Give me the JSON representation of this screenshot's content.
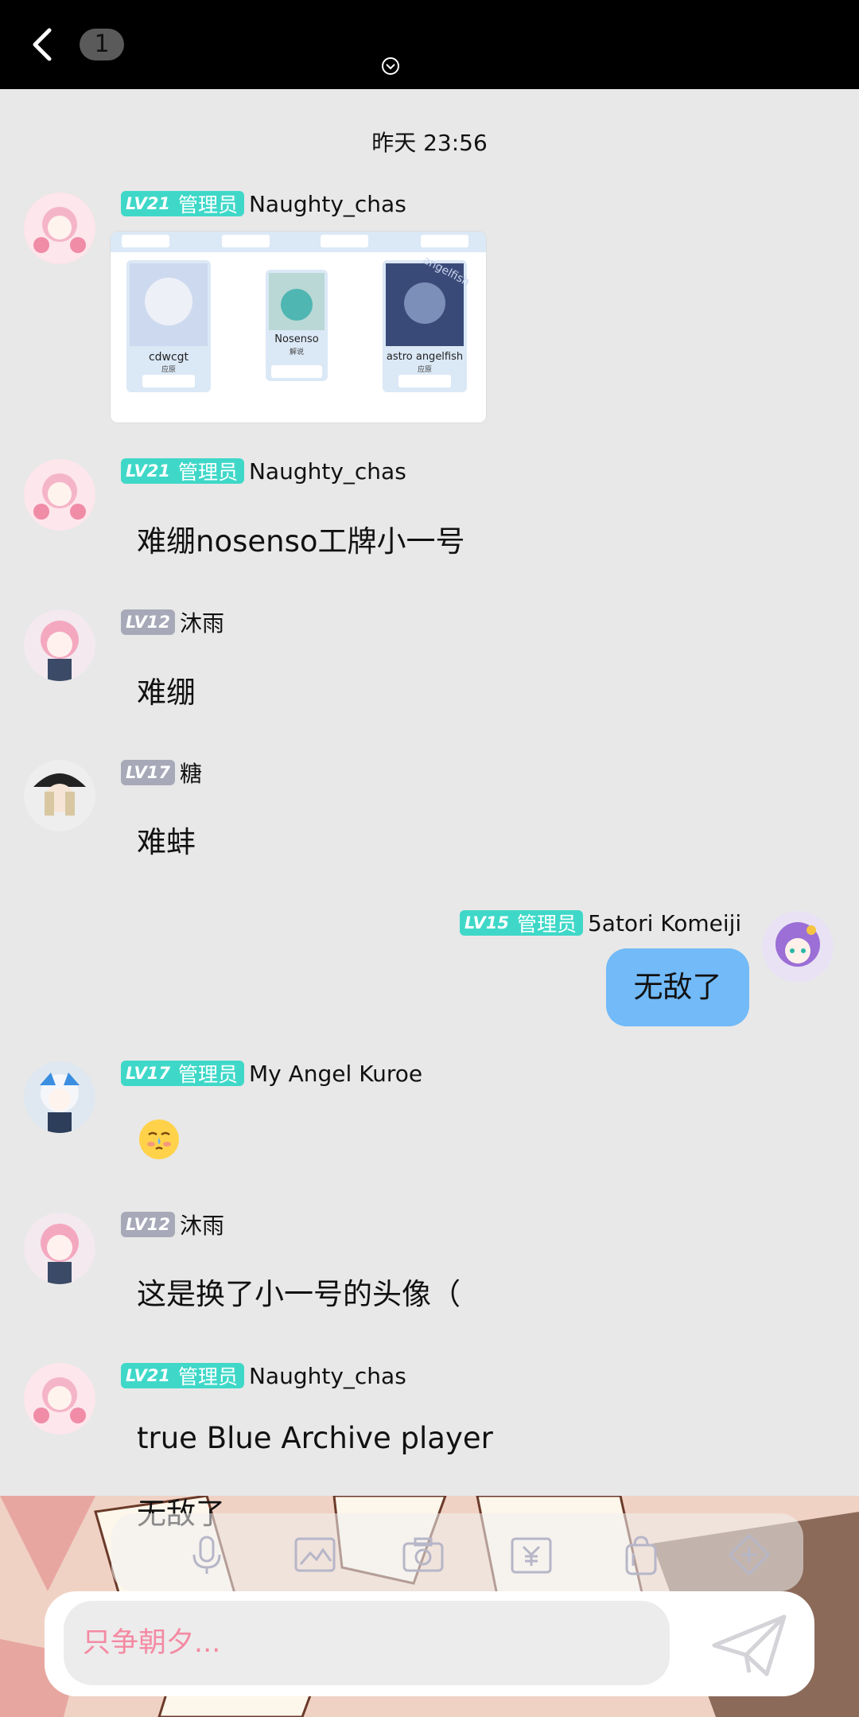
{
  "topbar": {
    "unread_count": "1"
  },
  "timestamp": "昨天 23:56",
  "messages": [
    {
      "level": "LV21",
      "role": "管理员",
      "name": "Naughty_chas"
    },
    {
      "level": "LV21",
      "role": "管理员",
      "name": "Naughty_chas",
      "text": "难绷nosenso工牌小一号"
    },
    {
      "level": "LV12",
      "name": "沐雨",
      "text": "难绷"
    },
    {
      "level": "LV17",
      "name": "糖",
      "text": "难蚌"
    },
    {
      "level": "LV15",
      "role": "管理员",
      "name": "5atori Komeiji",
      "text": "无敌了"
    },
    {
      "level": "LV17",
      "role": "管理员",
      "name": "My Angel Kuroe"
    },
    {
      "level": "LV12",
      "name": "沐雨",
      "text": "这是换了小一号的头像（"
    },
    {
      "level": "LV21",
      "role": "管理员",
      "name": "Naughty_chas",
      "text": "true Blue Archive player"
    }
  ],
  "image_card": {
    "cards": [
      {
        "name": "cdwcgt",
        "sub": "应原"
      },
      {
        "name": "Nosenso",
        "sub": "解说"
      },
      {
        "name": "astro angelfish",
        "sub": "应原"
      }
    ],
    "watermark": "angelfish"
  },
  "peek_text": "无敌了",
  "composer": {
    "placeholder": "只争朝夕..."
  },
  "colors": {
    "admin_badge": "#3fd8c8",
    "level_badge_gray": "#a7a9b8",
    "my_bubble": "#72baf8",
    "placeholder": "#f48aa3"
  },
  "icons": [
    "back-icon",
    "collapse-icon",
    "mic-icon",
    "image-icon",
    "camera-icon",
    "red-packet-icon",
    "bag-icon",
    "gift-icon",
    "send-icon",
    "emoji-sticker-icon"
  ]
}
